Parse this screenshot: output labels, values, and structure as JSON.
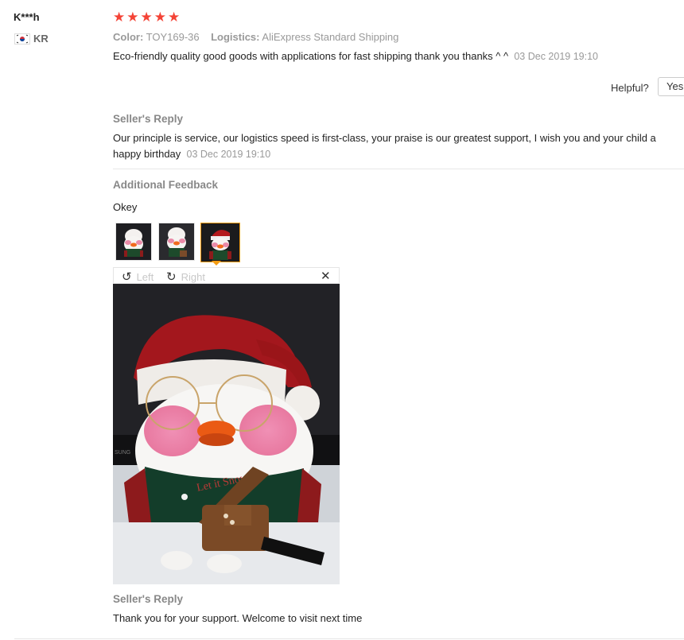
{
  "user": {
    "name": "K***h",
    "country": "KR"
  },
  "rating": {
    "stars": "★★★★★",
    "value": 5
  },
  "meta": {
    "color_label": "Color:",
    "color_value": "TOY169-36",
    "logistics_label": "Logistics:",
    "logistics_value": "AliExpress Standard Shipping"
  },
  "review": {
    "text": "Eco-friendly quality good goods with applications for fast shipping thank you thanks ^ ^",
    "date": "03 Dec 2019 19:10"
  },
  "helpful": {
    "label": "Helpful?",
    "yes": "Yes"
  },
  "seller_reply_1": {
    "title": "Seller's Reply",
    "text": "Our principle is service, our logistics speed is first-class, your praise is our greatest support, I wish you and your child a happy birthday",
    "date": "03 Dec 2019 19:10"
  },
  "additional": {
    "title": "Additional Feedback",
    "text": "Okey"
  },
  "viewer": {
    "left_label": "Left",
    "right_label": "Right",
    "photo_text": "Let it Snow",
    "tv_brand": "SUNG"
  },
  "seller_reply_2": {
    "title": "Seller's Reply",
    "text": "Thank you for your support. Welcome to visit next time"
  },
  "colors": {
    "star": "#f44336",
    "accent": "#f39c12",
    "muted": "#999999"
  }
}
